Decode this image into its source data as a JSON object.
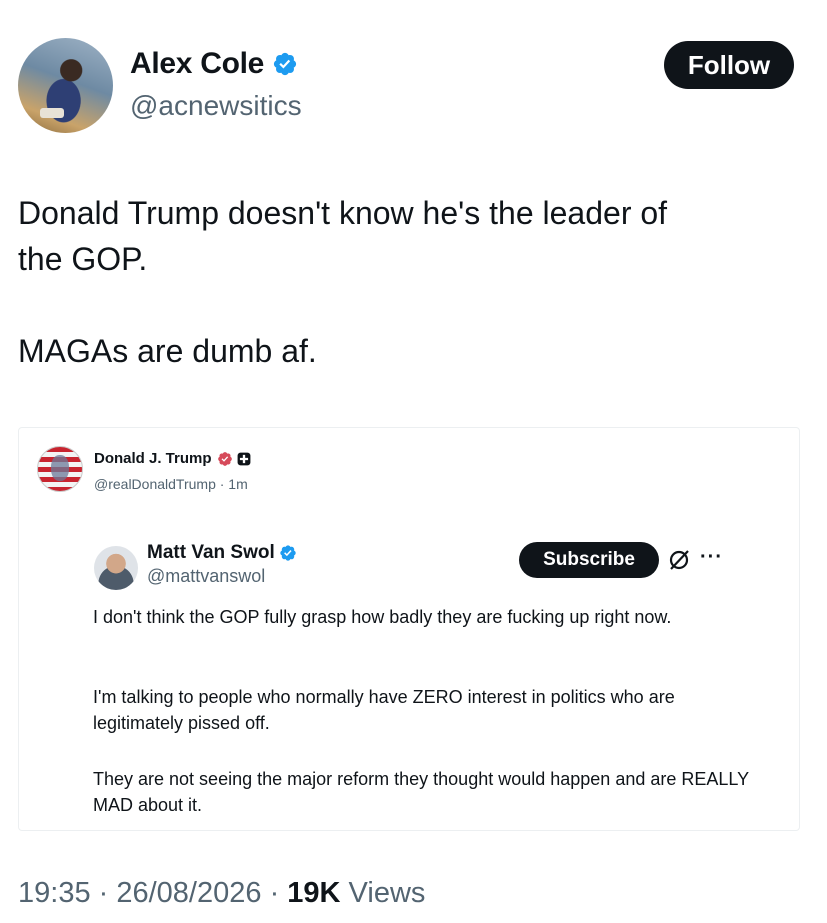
{
  "author": {
    "name": "Alex Cole",
    "handle": "@acnewsitics",
    "follow_label": "Follow"
  },
  "tweet": {
    "text": "Donald Trump doesn't know he's the leader of\nthe GOP.\n\nMAGAs are dumb af."
  },
  "quoted": {
    "name": "Donald J. Trump",
    "handle_time": "@realDonaldTrump · 1m",
    "inner": {
      "name": "Matt Van Swol",
      "handle": "@mattvanswol",
      "subscribe_label": "Subscribe",
      "more_label": "···",
      "paragraphs": [
        "I don't think the GOP fully grasp how badly they are fucking up right now.",
        "I'm talking to people who normally have ZERO interest in politics who are legitimately pissed off.",
        "They are not seeing the major reform they thought would happen and are REALLY MAD about it."
      ]
    }
  },
  "meta": {
    "time": "19:35",
    "sep1": " · ",
    "date": "26/08/2026",
    "sep2": " · ",
    "views_count": "19K",
    "views_label": " Views"
  },
  "colors": {
    "verified": "#1d9bf0",
    "gov_badge": "#d64a5a",
    "follow_bg": "#0f1419"
  }
}
